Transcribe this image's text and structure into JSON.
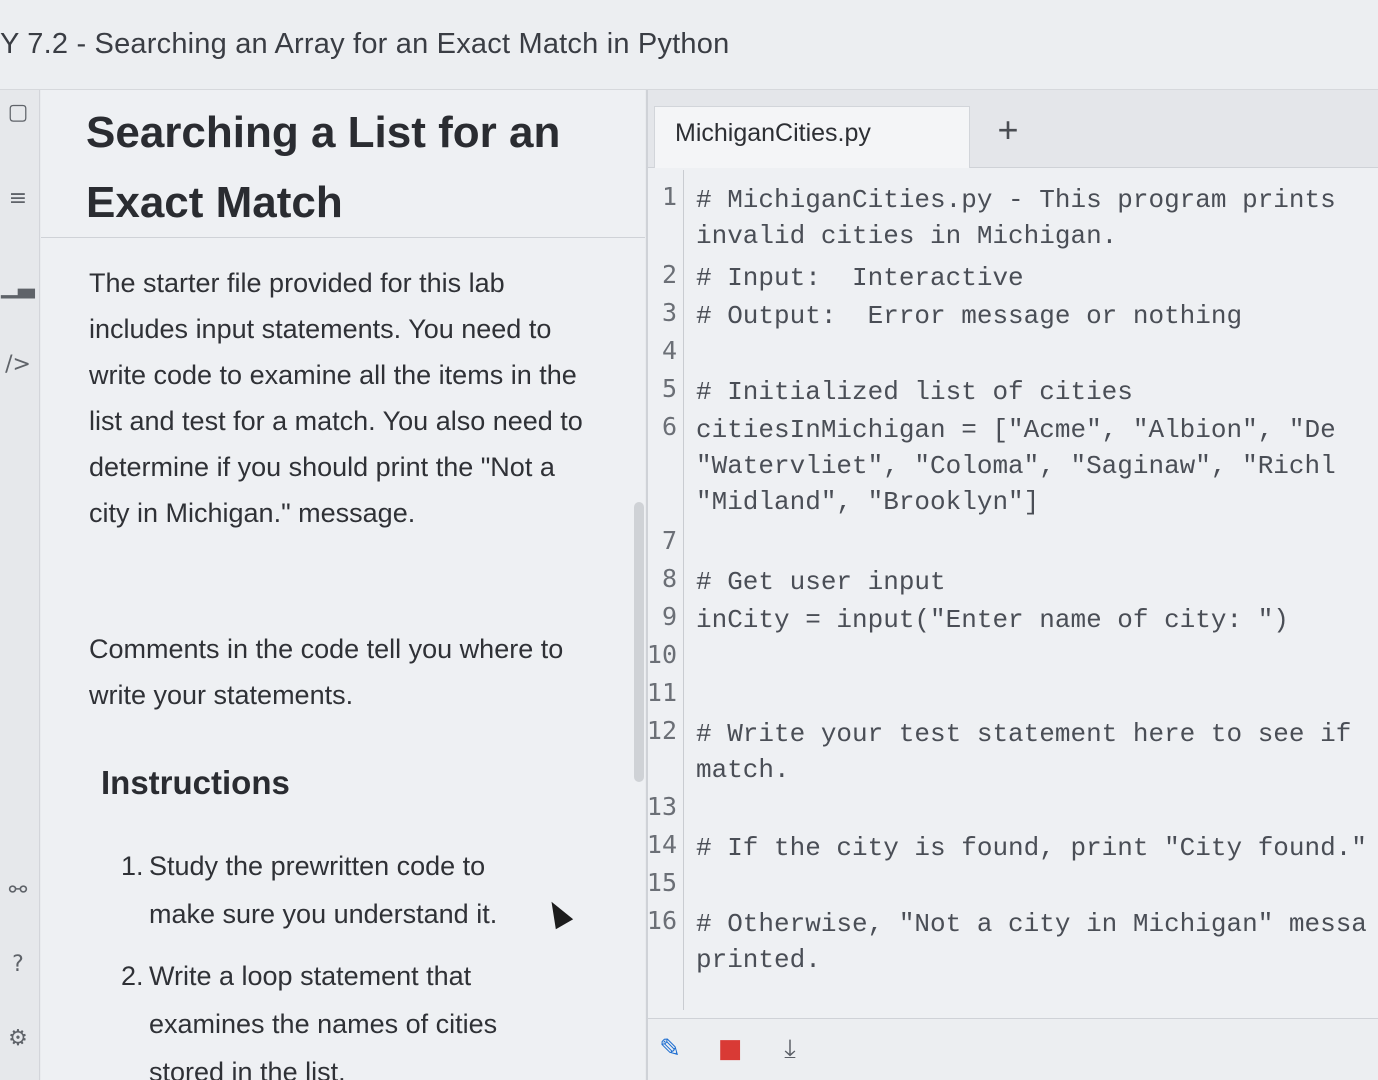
{
  "page": {
    "title": "Y 7.2 - Searching an Array for an Exact Match in Python"
  },
  "rail": {
    "icons": [
      "sidebar-toggle-icon",
      "menu-icon",
      "chart-icon",
      "code-icon",
      "share-icon",
      "help-icon",
      "settings-icon"
    ]
  },
  "instructions": {
    "heading": "Searching a List for an Exact Match",
    "paragraph1": "The starter file provided for this lab includes input statements. You need to write code to examine all the items in the list and test for a match. You also need to determine if you should print the \"Not a city in Michigan.\" message.",
    "paragraph2": "Comments in the code tell you where to write your statements.",
    "subheading": "Instructions",
    "steps": [
      {
        "num": "1.",
        "text": "Study the prewritten code to make sure you understand it."
      },
      {
        "num": "2.",
        "text": "Write a loop statement that examines the names of cities stored in the list."
      }
    ]
  },
  "editor": {
    "tab_name": "MichiganCities.py",
    "add_tab": "+",
    "lines": [
      {
        "n": "1",
        "text": "# MichiganCities.py - This program prints\ninvalid cities in Michigan."
      },
      {
        "n": "2",
        "text": "# Input:  Interactive"
      },
      {
        "n": "3",
        "text": "# Output:  Error message or nothing"
      },
      {
        "n": "4",
        "text": ""
      },
      {
        "n": "5",
        "text": "# Initialized list of cities"
      },
      {
        "n": "6",
        "text": "citiesInMichigan = [\"Acme\", \"Albion\", \"De\n\"Watervliet\", \"Coloma\", \"Saginaw\", \"Richl\n\"Midland\", \"Brooklyn\"]"
      },
      {
        "n": "7",
        "text": ""
      },
      {
        "n": "8",
        "text": "# Get user input"
      },
      {
        "n": "9",
        "text": "inCity = input(\"Enter name of city: \")"
      },
      {
        "n": "10",
        "text": ""
      },
      {
        "n": "11",
        "text": ""
      },
      {
        "n": "12",
        "text": "# Write your test statement here to see if\nmatch."
      },
      {
        "n": "13",
        "text": ""
      },
      {
        "n": "14",
        "text": "# If the city is found, print \"City found.\""
      },
      {
        "n": "15",
        "text": ""
      },
      {
        "n": "16",
        "text": "# Otherwise, \"Not a city in Michigan\" messa\nprinted."
      }
    ]
  },
  "toolbar": {
    "edit_icon": "pencil-icon",
    "delete_icon": "trash-icon",
    "download_icon": "download-icon",
    "colors": {
      "edit": "#1f6fd1",
      "delete": "#d93a35",
      "download": "#5a5e66"
    }
  }
}
